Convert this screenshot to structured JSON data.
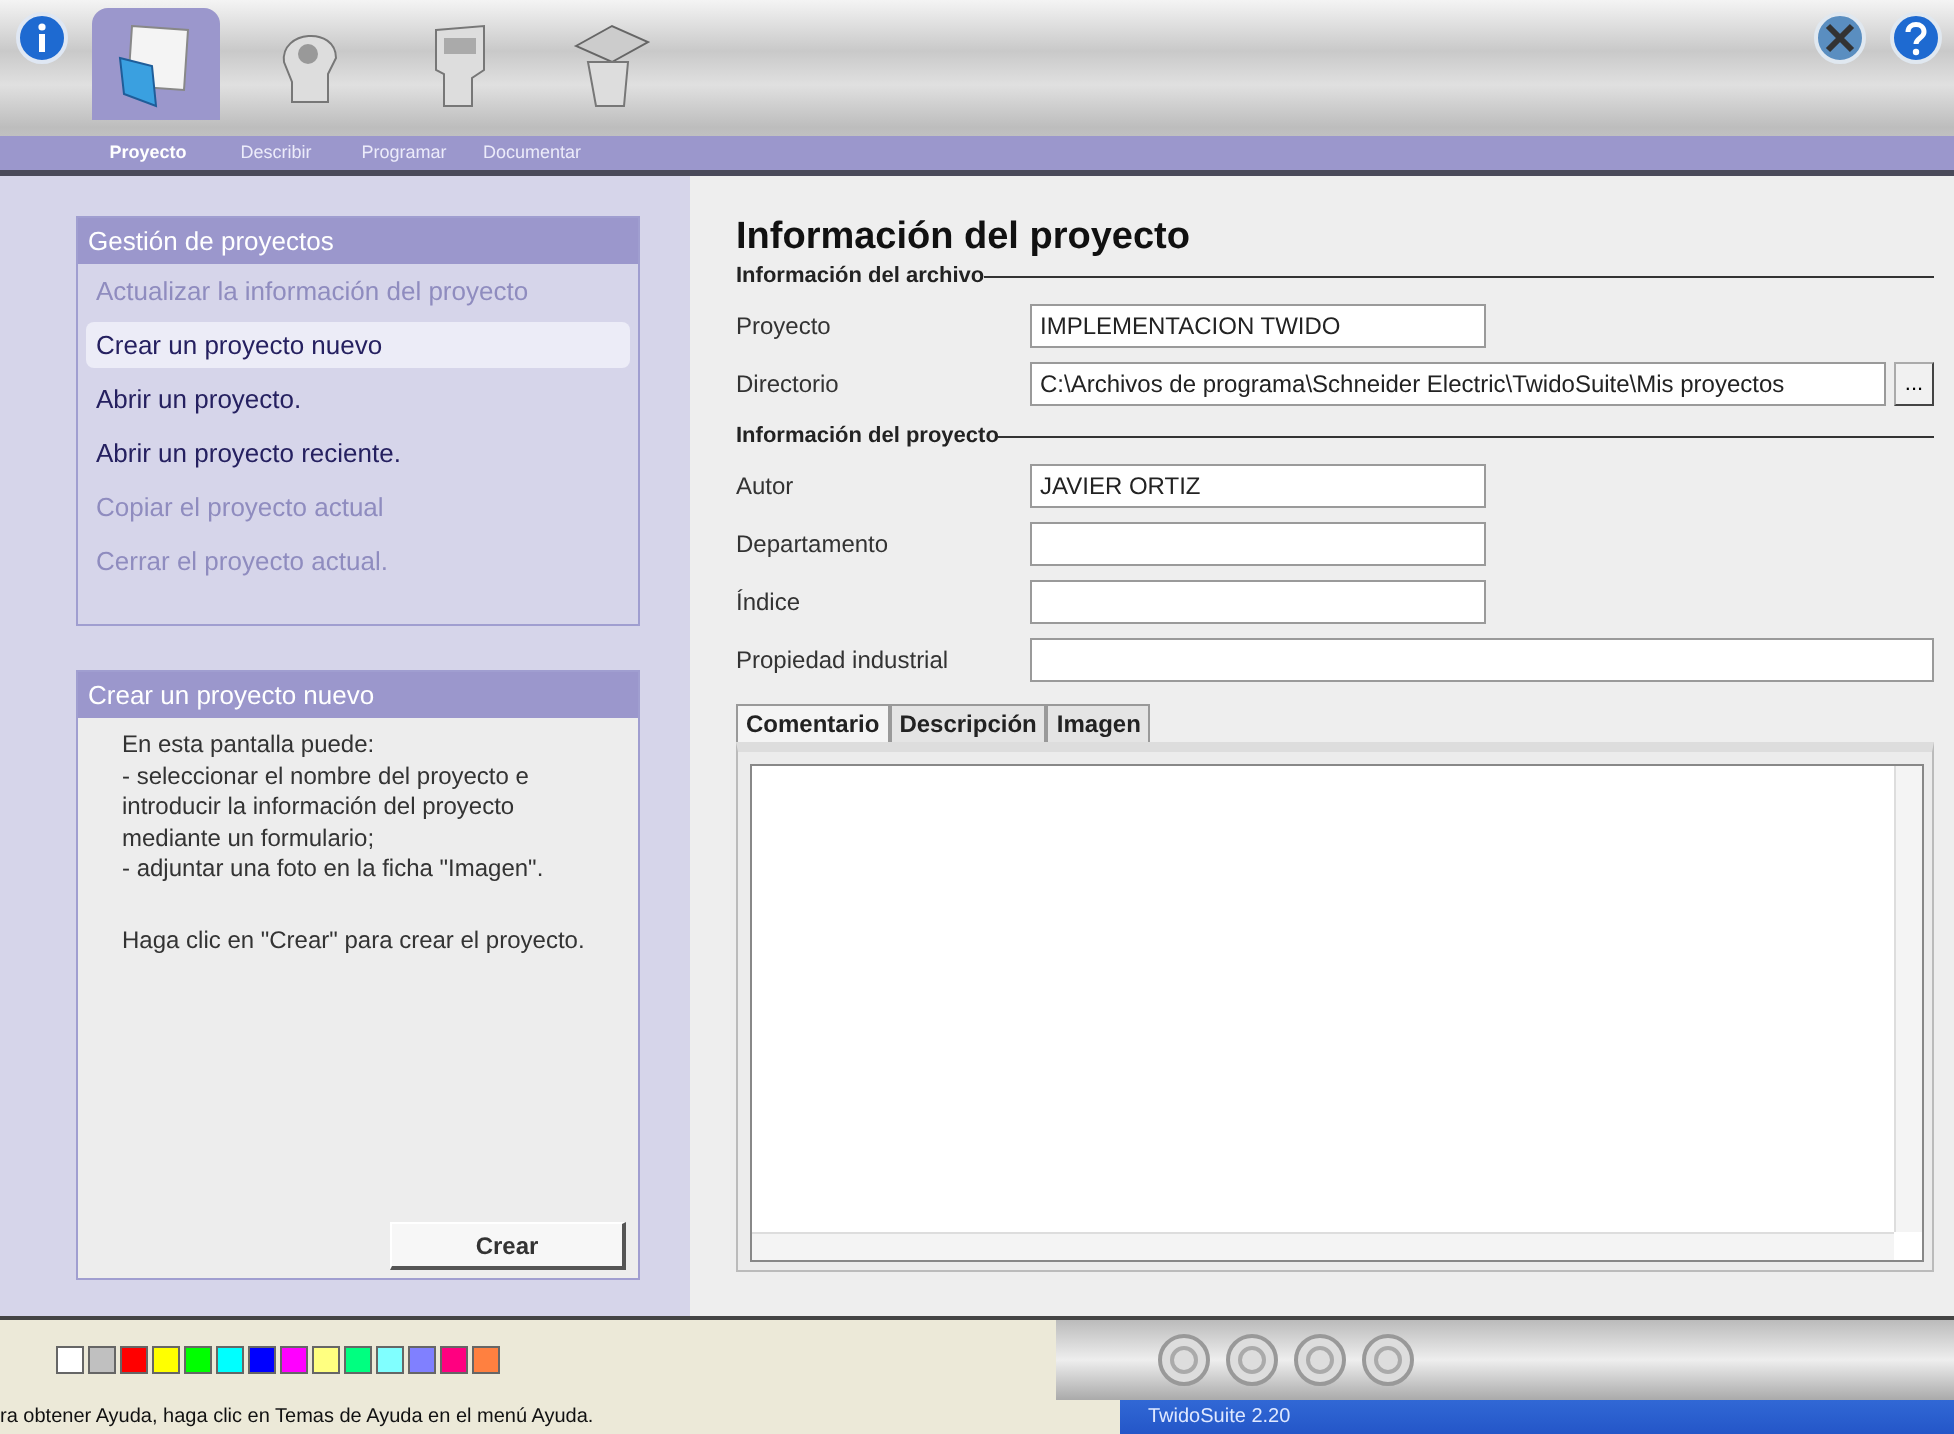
{
  "toolbar": {
    "tabs": [
      {
        "label": "Proyecto",
        "selected": true
      },
      {
        "label": "Describir",
        "selected": false
      },
      {
        "label": "Programar",
        "selected": false
      },
      {
        "label": "Documentar",
        "selected": false
      }
    ]
  },
  "task_menu": {
    "title": "Gestión de proyectos",
    "items": [
      {
        "label": "Actualizar la información del proyecto",
        "disabled": true,
        "selected": false
      },
      {
        "label": "Crear un proyecto nuevo",
        "disabled": false,
        "selected": true
      },
      {
        "label": "Abrir un proyecto.",
        "disabled": false,
        "selected": false
      },
      {
        "label": "Abrir un proyecto reciente.",
        "disabled": false,
        "selected": false
      },
      {
        "label": "Copiar el proyecto actual",
        "disabled": true,
        "selected": false
      },
      {
        "label": "Cerrar el proyecto actual.",
        "disabled": true,
        "selected": false
      }
    ]
  },
  "help": {
    "title": "Crear un proyecto nuevo",
    "paragraphs": [
      "En esta pantalla puede:\n - seleccionar el nombre del proyecto e introducir la información del proyecto mediante un formulario;\n - adjuntar una foto en la ficha \"Imagen\".",
      "Haga clic en \"Crear\" para crear el proyecto."
    ],
    "button": "Crear"
  },
  "form": {
    "title": "Información del proyecto",
    "sections": [
      {
        "title": "Información del archivo",
        "fields": [
          {
            "label": "Proyecto",
            "value": "IMPLEMENTACION TWIDO",
            "kind": "short"
          },
          {
            "label": "Directorio",
            "value": "C:\\Archivos de programa\\Schneider Electric\\TwidoSuite\\Mis proyectos",
            "kind": "path",
            "browse": "..."
          }
        ]
      },
      {
        "title": "Información del proyecto",
        "fields": [
          {
            "label": "Autor",
            "value": "JAVIER ORTIZ",
            "kind": "short"
          },
          {
            "label": "Departamento",
            "kind": "short"
          },
          {
            "label": "Índice",
            "kind": "short"
          },
          {
            "label": "Propiedad industrial",
            "kind": "long"
          }
        ]
      }
    ],
    "tabs": [
      {
        "label": "Comentario",
        "selected": true
      },
      {
        "label": "Descripción",
        "selected": false
      },
      {
        "label": "Imagen",
        "selected": false
      }
    ]
  },
  "palette": [
    {
      "color": "#ffffff"
    },
    {
      "color": "#c0c0c0"
    },
    {
      "color": "#ff0000"
    },
    {
      "color": "#ffff00"
    },
    {
      "color": "#00ff00"
    },
    {
      "color": "#00ffff"
    },
    {
      "color": "#0000ff"
    },
    {
      "color": "#ff00ff"
    },
    {
      "color": "#ffff80"
    },
    {
      "color": "#00ff80"
    },
    {
      "color": "#80ffff"
    },
    {
      "color": "#8080ff"
    },
    {
      "color": "#ff0080"
    },
    {
      "color": "#ff8040"
    }
  ],
  "status_bar": {
    "text": "ra obtener Ayuda, haga clic en Temas de Ayuda en el menú Ayuda.",
    "taskbar_item": "TwidoSuite 2.20"
  }
}
